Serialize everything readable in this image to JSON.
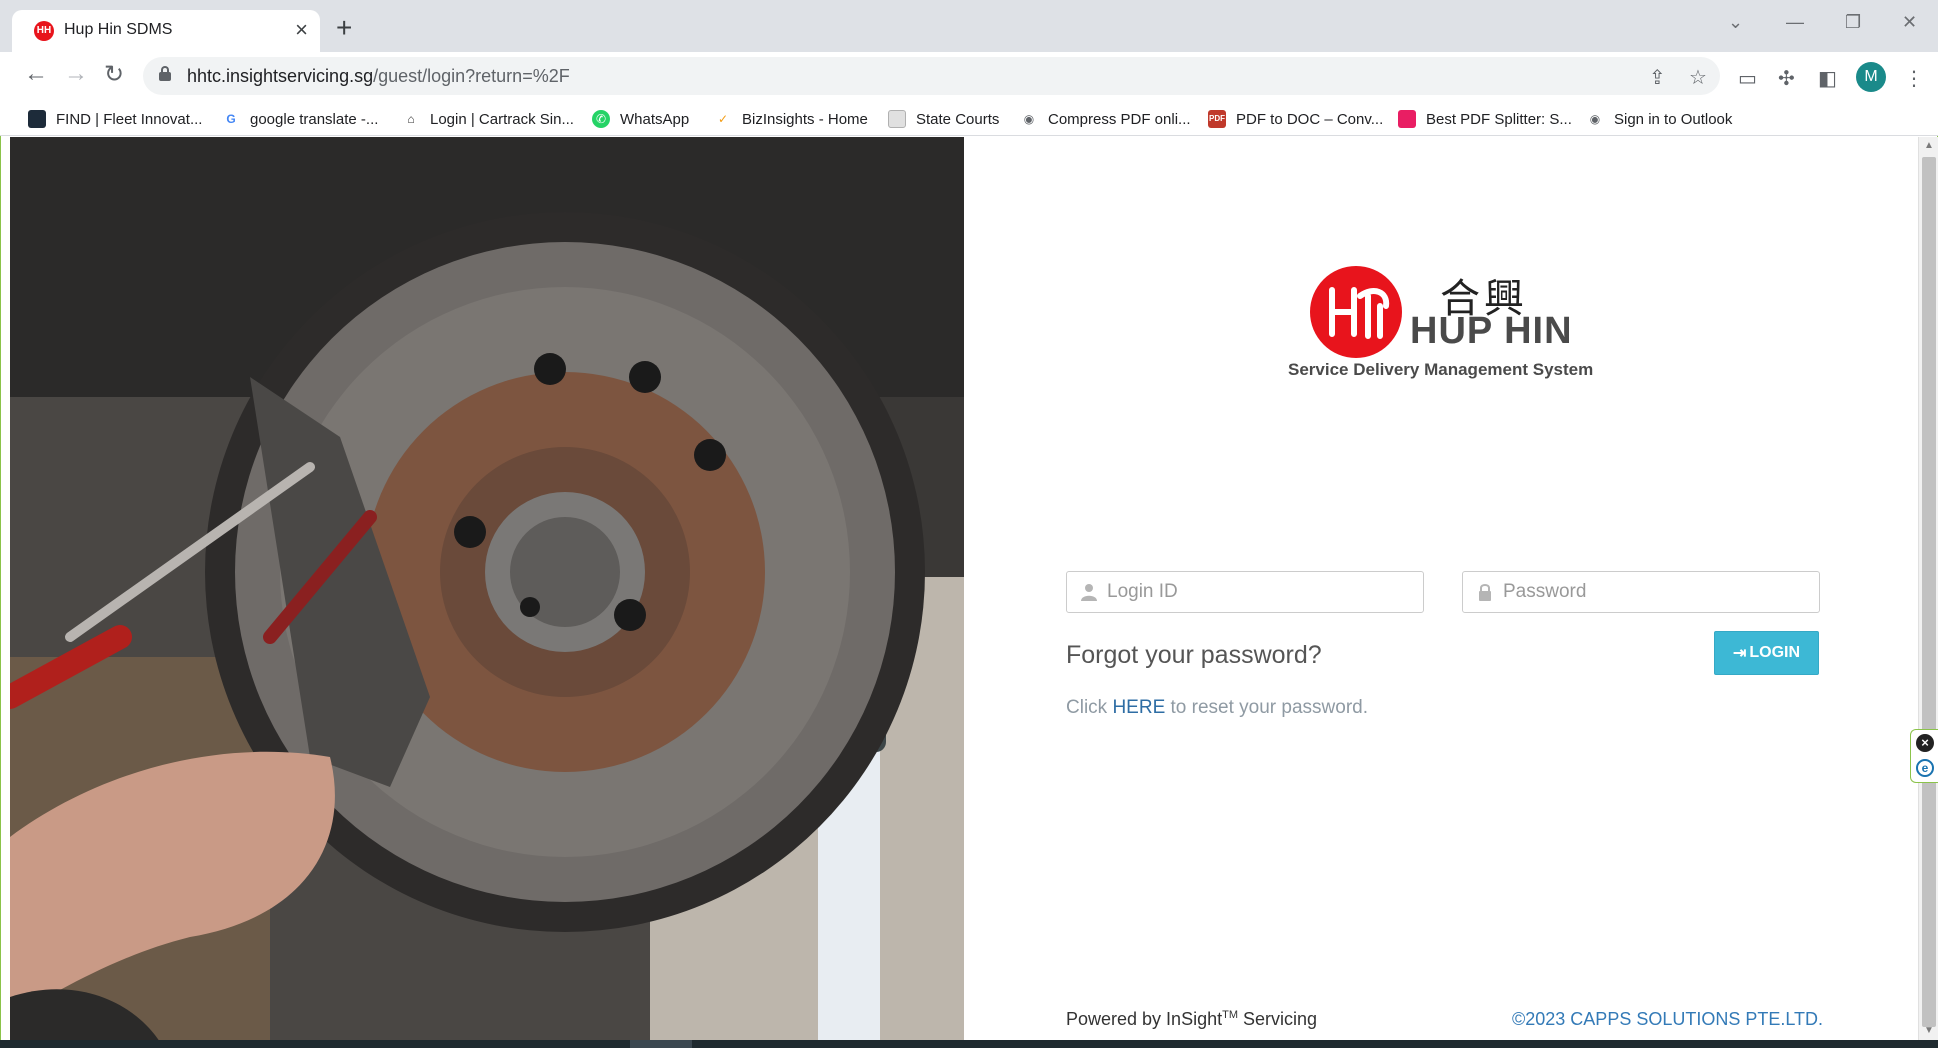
{
  "browser": {
    "tab_title": "Hup Hin SDMS",
    "tab_favicon_text": "HH",
    "url_host": "hhtc.insightservicing.sg",
    "url_path": "/guest/login?return=%2F",
    "profile_initial": "M"
  },
  "bookmarks": [
    {
      "label": "FIND | Fleet Innovat...",
      "icon": "find-icon",
      "color": "#1d2b3a"
    },
    {
      "label": "google translate -...",
      "icon": "google-icon",
      "color": "#4285f4"
    },
    {
      "label": "Login | Cartrack Sin...",
      "icon": "cartrack-icon",
      "color": "#333333"
    },
    {
      "label": "WhatsApp",
      "icon": "whatsapp-icon",
      "color": "#25d366"
    },
    {
      "label": "BizInsights - Home",
      "icon": "bizinsights-icon",
      "color": "#f39c12"
    },
    {
      "label": "State Courts",
      "icon": "state-courts-icon",
      "color": "#b0b0b0"
    },
    {
      "label": "Compress PDF onli...",
      "icon": "globe-icon",
      "color": "#5f6368"
    },
    {
      "label": "PDF to DOC – Conv...",
      "icon": "pdf-doc-icon",
      "color": "#c0392b"
    },
    {
      "label": "Best PDF Splitter: S...",
      "icon": "pdf-splitter-icon",
      "color": "#e91e63"
    },
    {
      "label": "Sign in to Outlook",
      "icon": "globe-icon",
      "color": "#5f6368"
    }
  ],
  "logo": {
    "chinese": "合興",
    "name": "HUP HIN",
    "subtitle": "Service Delivery Management System",
    "brand_color": "#e8141c"
  },
  "login": {
    "login_id_placeholder": "Login ID",
    "password_placeholder": "Password",
    "button_label": "LOGIN",
    "forgot_heading": "Forgot your password?",
    "reset_prefix": "Click ",
    "reset_link": "HERE",
    "reset_suffix": " to reset your password.",
    "button_color": "#3db8d5"
  },
  "footer": {
    "powered_prefix": "Powered by InSight",
    "powered_tm": "TM",
    "powered_suffix": " Servicing",
    "copyright": "©2023 CAPPS SOLUTIONS PTE.LTD."
  }
}
